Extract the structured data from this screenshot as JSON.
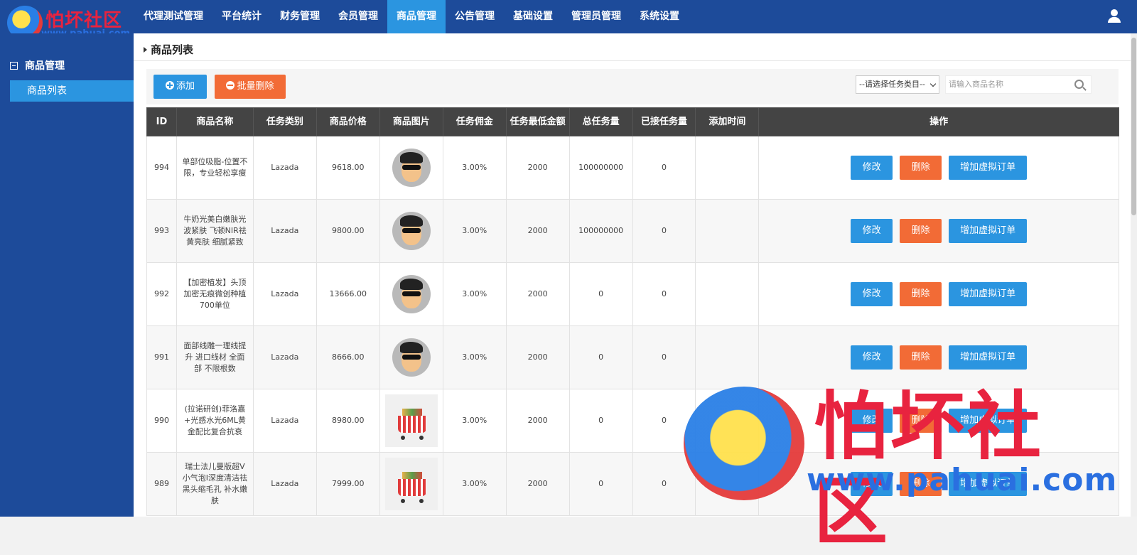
{
  "logo": {
    "brand": "怕坏社区",
    "url": "www.pahuai.com"
  },
  "nav": {
    "items": [
      {
        "label": "代理测试管理",
        "active": false
      },
      {
        "label": "平台统计",
        "active": false
      },
      {
        "label": "财务管理",
        "active": false
      },
      {
        "label": "会员管理",
        "active": false
      },
      {
        "label": "商品管理",
        "active": true
      },
      {
        "label": "公告管理",
        "active": false
      },
      {
        "label": "基础设置",
        "active": false
      },
      {
        "label": "管理员管理",
        "active": false
      },
      {
        "label": "系统设置",
        "active": false
      }
    ],
    "user_icon": "user-icon"
  },
  "sidebar": {
    "group_label": "商品管理",
    "items": [
      {
        "label": "商品列表",
        "active": true
      }
    ]
  },
  "page": {
    "breadcrumb": "商品列表"
  },
  "toolbar": {
    "add_label": "添加",
    "batch_delete_label": "批量删除",
    "category_select": "--请选择任务类目--",
    "search_placeholder": "请输入商品名称"
  },
  "table": {
    "columns": [
      "ID",
      "商品名称",
      "任务类别",
      "商品价格",
      "商品图片",
      "任务佣金",
      "任务最低金额",
      "总任务量",
      "已接任务量",
      "添加时间",
      "操作"
    ],
    "actions": {
      "edit": "修改",
      "delete": "删除",
      "add_virtual": "增加虚拟订单"
    },
    "rows": [
      {
        "id": "994",
        "name": "单部位吸脂-位置不限，专业轻松享瘦",
        "category": "Lazada",
        "price": "9618.00",
        "image": "avatar",
        "commission": "3.00%",
        "min_amount": "2000",
        "total": "100000000",
        "accepted": "0",
        "added": ""
      },
      {
        "id": "993",
        "name": "牛奶光美白嫩肤光波紧肤 飞顿NIR祛黄亮肤 细腻紧致",
        "category": "Lazada",
        "price": "9800.00",
        "image": "avatar",
        "commission": "3.00%",
        "min_amount": "2000",
        "total": "100000000",
        "accepted": "0",
        "added": ""
      },
      {
        "id": "992",
        "name": "【加密植发】头顶加密无痕微创种植700单位",
        "category": "Lazada",
        "price": "13666.00",
        "image": "avatar",
        "commission": "3.00%",
        "min_amount": "2000",
        "total": "0",
        "accepted": "0",
        "added": ""
      },
      {
        "id": "991",
        "name": "面部线雕一理线提升 进口线材 全面部 不限根数",
        "category": "Lazada",
        "price": "8666.00",
        "image": "avatar",
        "commission": "3.00%",
        "min_amount": "2000",
        "total": "0",
        "accepted": "0",
        "added": ""
      },
      {
        "id": "990",
        "name": "(拉诺研创)菲洛嘉+光感水光6ML黄金配比复合抗衰",
        "category": "Lazada",
        "price": "8980.00",
        "image": "cart",
        "commission": "3.00%",
        "min_amount": "2000",
        "total": "0",
        "accepted": "0",
        "added": ""
      },
      {
        "id": "989",
        "name": "瑞士法儿曼版超V小气泡I深度清洁祛黑头缩毛孔 补水嫩肤",
        "category": "Lazada",
        "price": "7999.00",
        "image": "cart",
        "commission": "3.00%",
        "min_amount": "2000",
        "total": "0",
        "accepted": "0",
        "added": ""
      }
    ]
  },
  "watermark": {
    "brand": "怕坏社区",
    "url": "www.pahuai.com"
  },
  "colors": {
    "nav_bg": "#1d4b9a",
    "accent": "#2b95e0",
    "danger": "#f26b36",
    "header_bg": "#444444"
  }
}
